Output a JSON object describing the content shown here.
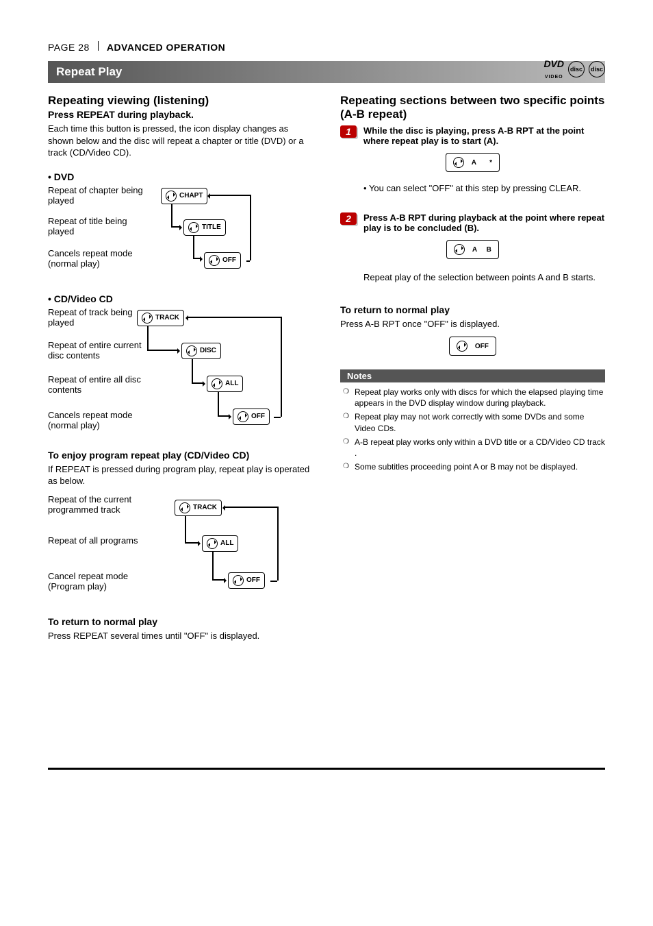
{
  "header": {
    "page": "PAGE 28",
    "section": "ADVANCED OPERATION"
  },
  "titleBar": "Repeat Play",
  "logos": {
    "dvd": "DVD",
    "dvdSub": "VIDEO",
    "disc1": "disc",
    "disc2": "disc"
  },
  "left": {
    "h2": "Repeating viewing (listening)",
    "sub": "Press REPEAT during playback.",
    "intro": "Each time this button is pressed, the icon display changes as shown below and the disc will repeat a chapter or title (DVD) or a track (CD/Video CD).",
    "dvdHead": "• DVD",
    "dvd": [
      {
        "text": "Repeat of chapter being played",
        "pill": "CHAPT"
      },
      {
        "text": "Repeat of title being played",
        "pill": "TITLE"
      },
      {
        "text": "Cancels repeat mode (normal play)",
        "pill": "OFF"
      }
    ],
    "cdHead": "• CD/Video CD",
    "cd": [
      {
        "text": "Repeat of track being played",
        "pill": "TRACK"
      },
      {
        "text": "Repeat of entire current disc contents",
        "pill": "DISC"
      },
      {
        "text": "Repeat of entire all disc contents",
        "pill": "ALL"
      },
      {
        "text": "Cancels repeat mode (normal play)",
        "pill": "OFF"
      }
    ],
    "progHead": "To enjoy program repeat play (CD/Video CD)",
    "progIntro": "If REPEAT is pressed during program play, repeat play is operated as below.",
    "prog": [
      {
        "text": "Repeat of the current programmed track",
        "pill": "TRACK"
      },
      {
        "text": "Repeat of all programs",
        "pill": "ALL"
      },
      {
        "text": "Cancel repeat mode (Program play)",
        "pill": "OFF"
      }
    ],
    "returnHead": "To return to normal play",
    "returnText": "Press REPEAT several times until \"OFF\" is displayed."
  },
  "right": {
    "h2": "Repeating sections between two specific points (A-B repeat)",
    "step1": "While the disc is playing, press A-B RPT at the point where repeat play is to start (A).",
    "pill1": "A       *",
    "step1note": "You can select \"OFF\" at this step by pressing CLEAR.",
    "step2": "Press A-B RPT during playback at the point where repeat play is to be concluded (B).",
    "pill2": "A     B",
    "step2after": "Repeat play of the selection between points A and B starts.",
    "returnHead": "To return to normal play",
    "returnText": "Press A-B RPT once \"OFF\" is displayed.",
    "pillOff": "OFF",
    "notesHead": "Notes",
    "notes": [
      "Repeat play works only with discs for which the elapsed playing time appears in the DVD display window during playback.",
      "Repeat play may not work correctly with some DVDs and some Video CDs.",
      "A-B repeat play works only within a DVD title or a CD/Video CD track .",
      "Some subtitles proceeding point A or B may not be displayed."
    ]
  }
}
